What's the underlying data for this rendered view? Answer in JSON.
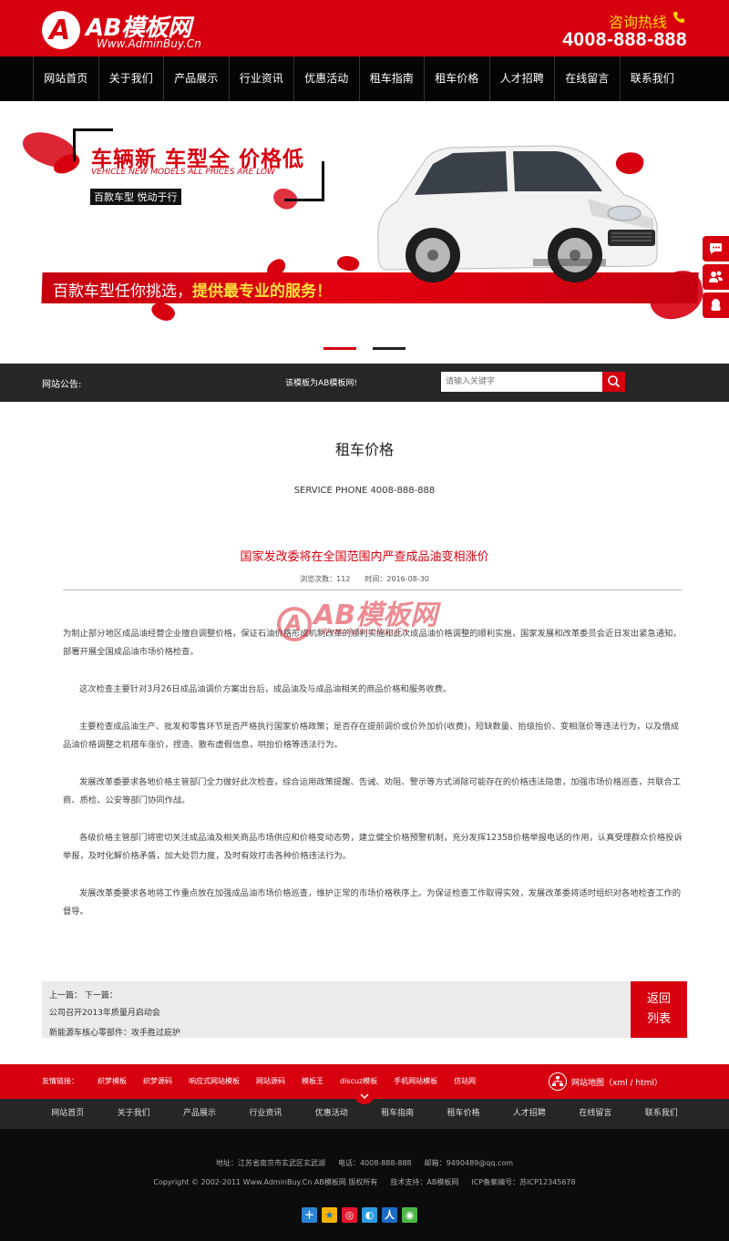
{
  "header": {
    "logo_mark": "A",
    "logo_text": "AB模板网",
    "logo_url": "Www.AdminBuy.Cn",
    "hotline_label": "咨询热线",
    "hotline_number": "4008-888-888"
  },
  "nav": {
    "items": [
      "网站首页",
      "关于我们",
      "产品展示",
      "行业资讯",
      "优惠活动",
      "租车指南",
      "租车价格",
      "人才招聘",
      "在线留言",
      "联系我们"
    ]
  },
  "banner": {
    "headline": "车辆新 车型全 价格低",
    "headline_en": "VEHICLE NEW MODELS ALL PRICES ARE LOW",
    "tagline": "百款车型 悦动于行",
    "slogan_main": "百款车型任你挑选，",
    "slogan_highlight": "提供最专业的服务！",
    "active_slide": 1,
    "slide_count": 2
  },
  "notice": {
    "label": "网站公告:",
    "text": "该模板为AB模板网!",
    "search_placeholder": "请输入关键字"
  },
  "page": {
    "title": "租车价格",
    "service_phone": "SERVICE PHONE 4008-888-888"
  },
  "article": {
    "title": "国家发改委将在全国范围内严查成品油变相涨价",
    "views": "浏览次数：112",
    "date": "时间：2016-08-30",
    "watermark_text": "AB模板网",
    "watermark_url": "Www.AdminBuy.Cn",
    "paragraphs": [
      "为制止部分地区成品油经营企业擅自调整价格，保证石油价格形成机制改革的顺利实施和此次成品油价格调整的顺利实施，国家发展和改革委员会近日发出紧急通知，部署开展全国成品油市场价格检查。",
      "这次检查主要针对3月26日成品油调价方案出台后，成品油及与成品油相关的商品价格和服务收费。",
      "主要检查成品油生产、批发和零售环节是否严格执行国家价格政策；是否存在提前调价或价外加价(收费)，短缺数量、抬级抬价、变相涨价等违法行为，以及借成品油价格调整之机搭车涨价，捏造、散布虚假信息，哄抬价格等违法行为。",
      "发展改革委要求各地价格主管部门全力做好此次检查，综合运用政策提醒、告诫、劝阻、警示等方式消除可能存在的价格违法隐患，加强市场价格巡查，共联合工商、质检、公安等部门协同作战。",
      "各级价格主管部门将密切关注成品油及相关商品市场供应和价格变动态势，建立健全价格预警机制，充分发挥12358价格举报电话的作用，认真受理群众价格投诉举报，及时化解价格矛盾，加大处罚力度，及时有效打击各种价格违法行为。",
      "发展改革委要求各地将工作重点放在加强成品油市场价格巡查，维护正常的市场价格秩序上。为保证检查工作取得实效，发展改革委将适时组织对各地检查工作的督导。"
    ]
  },
  "prev_next": {
    "label": "上一篇： 下一篇：",
    "prev": "公司召开2013年质量月启动会",
    "next": "新能源车核心零部件：攻手胜过庇护",
    "back_line1": "返回",
    "back_line2": "列表"
  },
  "links": {
    "label": "友情链接：",
    "items": [
      "织梦模板",
      "织梦源码",
      "响应式网站模板",
      "网站源码",
      "模板王",
      "discuz模板",
      "手机网站模板",
      "仿站网"
    ],
    "sitemap": "网站地图（xml / html）"
  },
  "footer_nav": {
    "items": [
      "网站首页",
      "关于我们",
      "产品展示",
      "行业资讯",
      "优惠活动",
      "租车指南",
      "租车价格",
      "人才招聘",
      "在线留言",
      "联系我们"
    ]
  },
  "footer": {
    "address": "地址：江苏省南京市玄武区玄武湖",
    "phone": "电话：4008-888-888",
    "email": "邮箱：9490489@qq.com",
    "copyright": "Copyright © 2002-2011 Www.AdminBuy.Cn AB模板网 版权所有",
    "support": "技术支持：AB模板网",
    "icp": "ICP备案编号：苏ICP12345678"
  },
  "colors": {
    "brand_red": "#d7000f",
    "nav_black": "#050505",
    "notice_gray": "#262626",
    "hotline_yellow": "#ffd800"
  },
  "icons": {
    "float": [
      "chat-icon",
      "users-icon",
      "qq-icon"
    ],
    "share": [
      "plus-share-icon",
      "qzone-icon",
      "weibo-icon",
      "tencent-weibo-icon",
      "renren-icon",
      "wechat-icon"
    ]
  }
}
